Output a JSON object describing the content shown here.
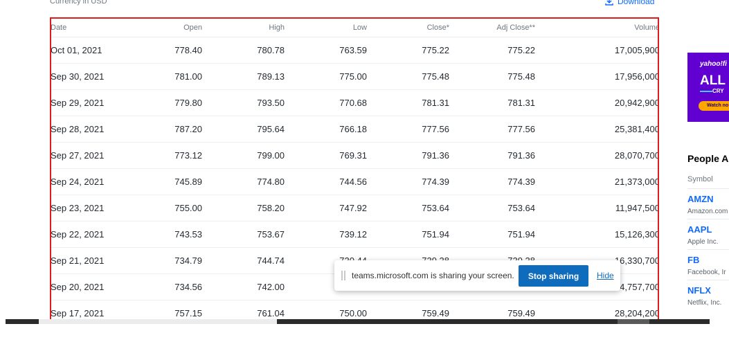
{
  "header": {
    "currency_label": "Currency in USD",
    "download_label": "Download"
  },
  "table": {
    "columns": [
      "Date",
      "Open",
      "High",
      "Low",
      "Close*",
      "Adj Close**",
      "Volume"
    ],
    "rows": [
      [
        "Oct 01, 2021",
        "778.40",
        "780.78",
        "763.59",
        "775.22",
        "775.22",
        "17,005,900"
      ],
      [
        "Sep 30, 2021",
        "781.00",
        "789.13",
        "775.00",
        "775.48",
        "775.48",
        "17,956,000"
      ],
      [
        "Sep 29, 2021",
        "779.80",
        "793.50",
        "770.68",
        "781.31",
        "781.31",
        "20,942,900"
      ],
      [
        "Sep 28, 2021",
        "787.20",
        "795.64",
        "766.18",
        "777.56",
        "777.56",
        "25,381,400"
      ],
      [
        "Sep 27, 2021",
        "773.12",
        "799.00",
        "769.31",
        "791.36",
        "791.36",
        "28,070,700"
      ],
      [
        "Sep 24, 2021",
        "745.89",
        "774.80",
        "744.56",
        "774.39",
        "774.39",
        "21,373,000"
      ],
      [
        "Sep 23, 2021",
        "755.00",
        "758.20",
        "747.92",
        "753.64",
        "753.64",
        "11,947,500"
      ],
      [
        "Sep 22, 2021",
        "743.53",
        "753.67",
        "739.12",
        "751.94",
        "751.94",
        "15,126,300"
      ],
      [
        "Sep 21, 2021",
        "734.79",
        "744.74",
        "730.44",
        "739.38",
        "739.38",
        "16,330,700"
      ],
      [
        "Sep 20, 2021",
        "734.56",
        "742.00",
        "",
        "",
        "",
        "24,757,700"
      ],
      [
        "Sep 17, 2021",
        "757.15",
        "761.04",
        "750.00",
        "759.49",
        "759.49",
        "28,204,200"
      ]
    ]
  },
  "ad": {
    "brand": "yahoo!fi",
    "headline": "ALL I",
    "sub": "CRY",
    "cta": "Watch no",
    "background": "#6001d2",
    "cta_color": "#ffa700"
  },
  "people_also_watch": {
    "title": "People A",
    "symbol_header": "Symbol",
    "items": [
      {
        "symbol": "AMZN",
        "name": "Amazon.com"
      },
      {
        "symbol": "AAPL",
        "name": "Apple Inc."
      },
      {
        "symbol": "FB",
        "name": "Facebook, Ir"
      },
      {
        "symbol": "NFLX",
        "name": "Netflix, Inc."
      }
    ]
  },
  "screen_share": {
    "message": "teams.microsoft.com is sharing your screen.",
    "stop_label": "Stop sharing",
    "hide_label": "Hide",
    "accent": "#0f6cbd"
  },
  "colors": {
    "highlight_border": "#e01b1b",
    "link": "#0f69ff"
  }
}
